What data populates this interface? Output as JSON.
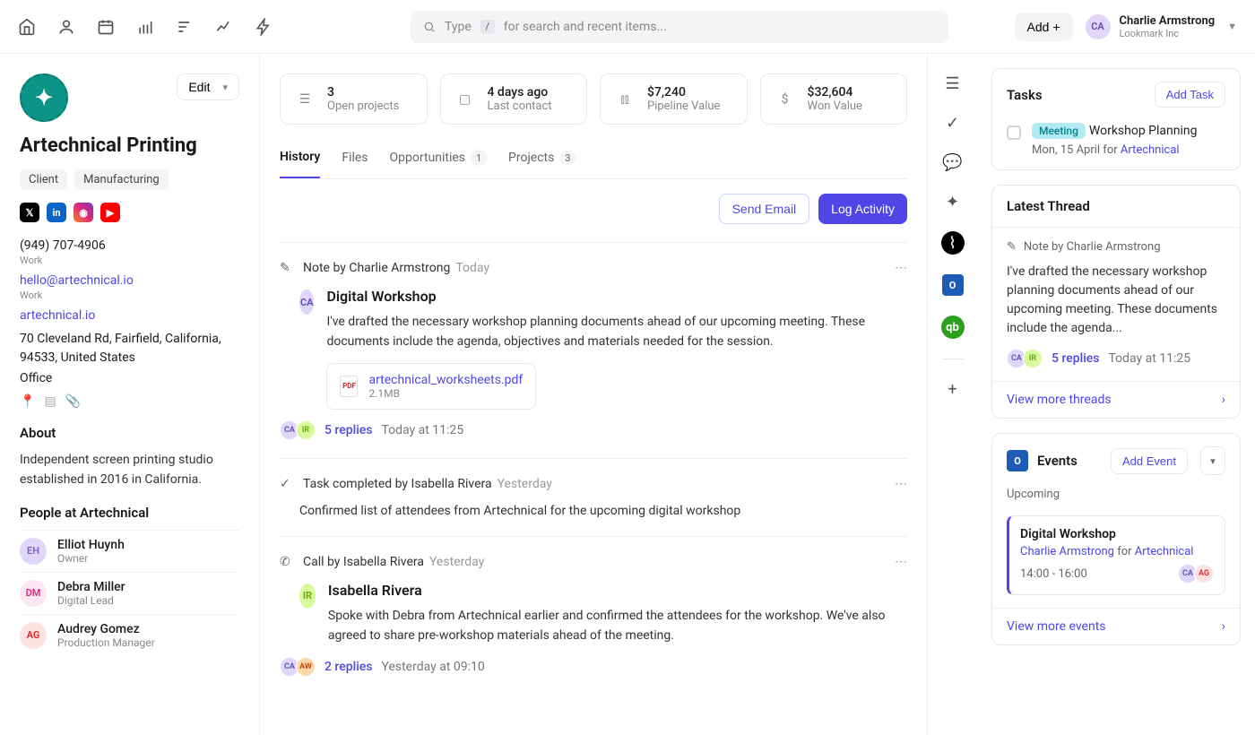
{
  "topbar": {
    "search_hint_left": "Type",
    "search_kbd": "/",
    "search_hint": "for search and recent items...",
    "add_label": "Add +",
    "user": {
      "initials": "CA",
      "name": "Charlie Armstrong",
      "company": "Lookmark Inc"
    }
  },
  "company": {
    "name": "Artechnical Printing",
    "edit_label": "Edit",
    "tags": [
      "Client",
      "Manufacturing"
    ],
    "phone": "(949) 707-4906",
    "phone_label": "Work",
    "email": "hello@artechnical.io",
    "email_label": "Work",
    "website": "artechnical.io",
    "address": "70 Cleveland Rd, Fairfield, California, 94533, United States",
    "address_label": "Office",
    "about_title": "About",
    "about": "Independent screen printing studio established in 2016 in California.",
    "people_title": "People at Artechnical",
    "people": [
      {
        "initials": "EH",
        "name": "Elliot Huynh",
        "role": "Owner"
      },
      {
        "initials": "DM",
        "name": "Debra Miller",
        "role": "Digital Lead"
      },
      {
        "initials": "AG",
        "name": "Audrey Gomez",
        "role": "Production Manager"
      }
    ]
  },
  "stats": [
    {
      "value": "3",
      "label": "Open projects"
    },
    {
      "value": "4 days ago",
      "label": "Last contact"
    },
    {
      "value": "$7,240",
      "label": "Pipeline Value"
    },
    {
      "value": "$32,604",
      "label": "Won Value"
    }
  ],
  "tabs": {
    "history": "History",
    "files": "Files",
    "opps": "Opportunities",
    "opps_count": "1",
    "projects": "Projects",
    "projects_count": "3"
  },
  "actions": {
    "send_email": "Send Email",
    "log_activity": "Log Activity"
  },
  "feed": {
    "note": {
      "header": "Note by Charlie Armstrong",
      "when": "Today",
      "avatar": "CA",
      "title": "Digital Workshop",
      "body": "I've drafted the necessary workshop planning documents ahead of our upcoming meeting. These documents include the agenda, objectives and materials needed for the session.",
      "file_name": "artechnical_worksheets.pdf",
      "file_size": "2.1MB",
      "replies": "5 replies",
      "reply_time": "Today at 11:25"
    },
    "task": {
      "header": "Task completed by Isabella Rivera",
      "when": "Yesterday",
      "body": "Confirmed list of attendees from Artechnical for the upcoming digital workshop"
    },
    "call": {
      "header": "Call by Isabella Rivera",
      "when": "Yesterday",
      "avatar": "IR",
      "title": "Isabella Rivera",
      "body": "Spoke with Debra from Artechnical earlier and confirmed the attendees for the workshop. We've also agreed to share pre-workshop materials ahead of the meeting.",
      "replies": "2 replies",
      "reply_time": "Yesterday at 09:10"
    }
  },
  "tasks_panel": {
    "title": "Tasks",
    "add": "Add Task",
    "pill": "Meeting",
    "name": "Workshop Planning",
    "sub_date": "Mon, 15 April for ",
    "sub_link": "Artechnical"
  },
  "thread_panel": {
    "title": "Latest Thread",
    "header": "Note by Charlie Armstrong",
    "body": "I've drafted the necessary workshop planning documents ahead of our upcoming meeting. These documents include the agenda...",
    "replies": "5 replies",
    "reply_time": "Today at 11:25",
    "more": "View more threads"
  },
  "events_panel": {
    "title": "Events",
    "add": "Add Event",
    "upcoming": "Upcoming",
    "e_title": "Digital Workshop",
    "e_who": "Charlie Armstrong",
    "e_for": " for ",
    "e_org": "Artechnical",
    "e_time": "14:00 - 16:00",
    "more": "View more events"
  }
}
